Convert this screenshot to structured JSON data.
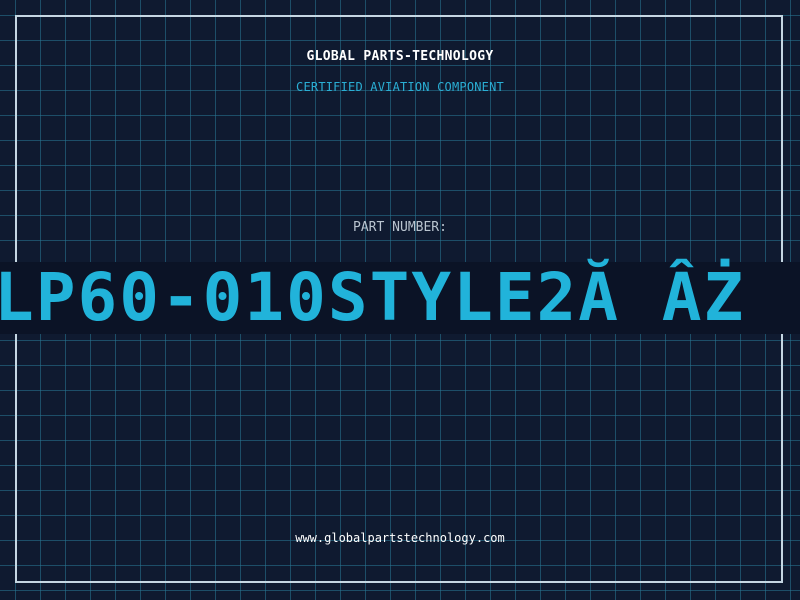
{
  "header": {
    "company": "GLOBAL PARTS-TECHNOLOGY",
    "tagline": "CERTIFIED AVIATION COMPONENT"
  },
  "part": {
    "label": "PART NUMBER:",
    "number": "LP60-010STYLE2Ă ÂŻ"
  },
  "footer": {
    "url": "www.globalpartstechnology.com"
  },
  "colors": {
    "background": "#0f1a30",
    "grid": "#2878a0",
    "frame": "#c5d6e2",
    "accent": "#21b3da",
    "band": "#0b1326"
  }
}
